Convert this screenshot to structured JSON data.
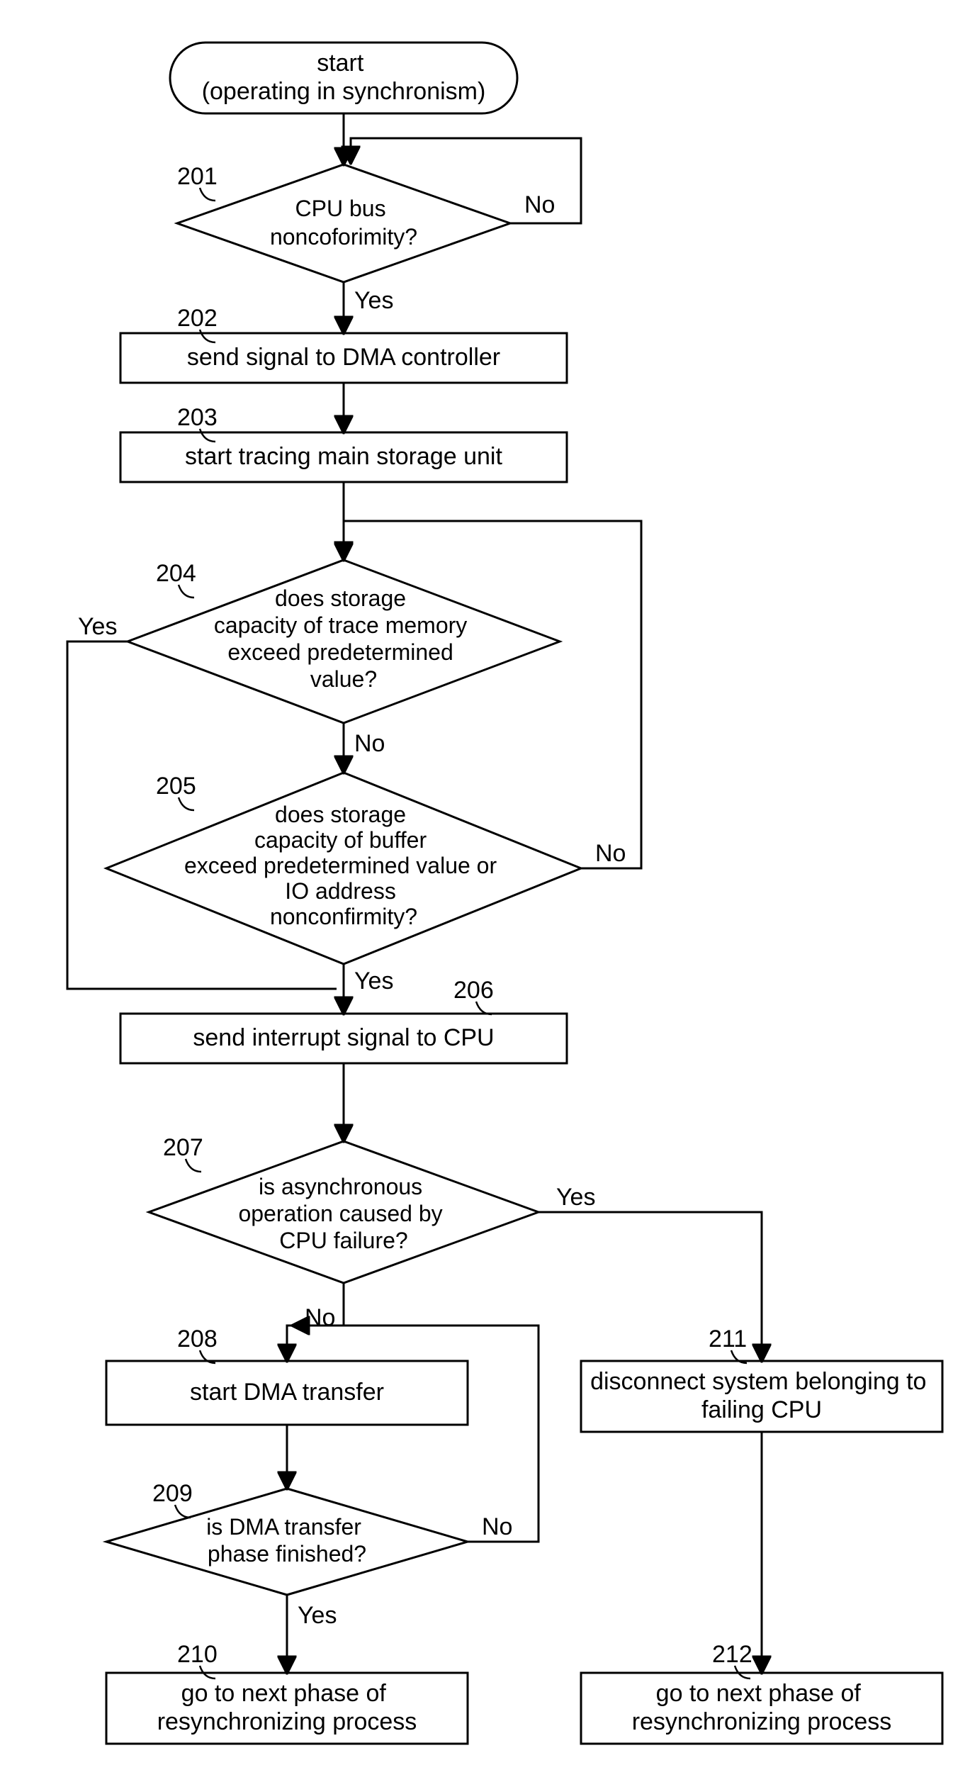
{
  "chart_data": {
    "type": "diagram",
    "title": "",
    "nodes": [
      {
        "id": "start",
        "type": "terminator",
        "ref": null,
        "lines": [
          "start",
          "(operating in synchronism)"
        ]
      },
      {
        "id": "d201",
        "type": "decision",
        "ref": "201",
        "lines": [
          "CPU bus",
          "noncoforimity?"
        ],
        "outs": {
          "yes": "Yes",
          "no": "No"
        }
      },
      {
        "id": "p202",
        "type": "process",
        "ref": "202",
        "lines": [
          "send signal to DMA controller"
        ]
      },
      {
        "id": "p203",
        "type": "process",
        "ref": "203",
        "lines": [
          "start tracing main storage unit"
        ]
      },
      {
        "id": "d204",
        "type": "decision",
        "ref": "204",
        "lines": [
          "does storage",
          "capacity of trace memory",
          "exceed predetermined",
          "value?"
        ],
        "outs": {
          "yes": "Yes",
          "no": "No"
        }
      },
      {
        "id": "d205",
        "type": "decision",
        "ref": "205",
        "lines": [
          "does storage",
          "capacity of buffer",
          "exceed predetermined value or",
          "IO address",
          "nonconfirmity?"
        ],
        "outs": {
          "yes": "Yes",
          "no": "No"
        }
      },
      {
        "id": "p206",
        "type": "process",
        "ref": "206",
        "lines": [
          "send interrupt signal to CPU"
        ]
      },
      {
        "id": "d207",
        "type": "decision",
        "ref": "207",
        "lines": [
          "is asynchronous",
          "operation caused by",
          "CPU failure?"
        ],
        "outs": {
          "yes": "Yes",
          "no": "No"
        }
      },
      {
        "id": "p208",
        "type": "process",
        "ref": "208",
        "lines": [
          "start DMA transfer"
        ]
      },
      {
        "id": "d209",
        "type": "decision",
        "ref": "209",
        "lines": [
          "is DMA transfer",
          "phase finished?"
        ],
        "outs": {
          "yes": "Yes",
          "no": "No"
        }
      },
      {
        "id": "p210",
        "type": "process",
        "ref": "210",
        "lines": [
          "go to next phase of",
          "resynchronizing process"
        ]
      },
      {
        "id": "p211",
        "type": "process",
        "ref": "211",
        "lines": [
          "disconnect system belonging to",
          "failing CPU"
        ]
      },
      {
        "id": "p212",
        "type": "process",
        "ref": "212",
        "lines": [
          "go to next phase of",
          "resynchronizing process"
        ]
      }
    ],
    "edges": [
      {
        "from": "start",
        "to": "d201"
      },
      {
        "from": "d201",
        "to": "d201",
        "label": "No",
        "loop": true
      },
      {
        "from": "d201",
        "to": "p202",
        "label": "Yes"
      },
      {
        "from": "p202",
        "to": "p203"
      },
      {
        "from": "p203",
        "to": "d204"
      },
      {
        "from": "d204",
        "to": "p206",
        "label": "Yes",
        "via": "left"
      },
      {
        "from": "d204",
        "to": "d205",
        "label": "No"
      },
      {
        "from": "d205",
        "to": "d204",
        "label": "No",
        "loop": true,
        "via": "right"
      },
      {
        "from": "d205",
        "to": "p206",
        "label": "Yes"
      },
      {
        "from": "p206",
        "to": "d207"
      },
      {
        "from": "d207",
        "to": "p211",
        "label": "Yes"
      },
      {
        "from": "d207",
        "to": "p208",
        "label": "No"
      },
      {
        "from": "p208",
        "to": "d209"
      },
      {
        "from": "d209",
        "to": "p208",
        "label": "No",
        "loop": true,
        "via": "right"
      },
      {
        "from": "d209",
        "to": "p210",
        "label": "Yes"
      },
      {
        "from": "p211",
        "to": "p212"
      }
    ]
  }
}
